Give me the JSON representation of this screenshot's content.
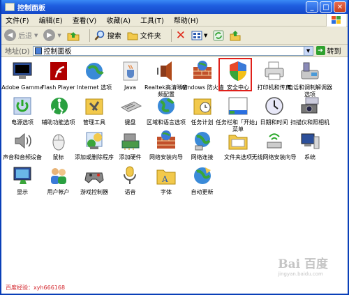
{
  "window": {
    "title": "控制面板"
  },
  "menu": [
    "文件(F)",
    "编辑(E)",
    "查看(V)",
    "收藏(A)",
    "工具(T)",
    "帮助(H)"
  ],
  "toolbar": {
    "back": "后退",
    "search": "搜索",
    "folders": "文件夹"
  },
  "address": {
    "label": "地址(D)",
    "value": "控制面板",
    "go": "转到"
  },
  "items": [
    {
      "label": "Adobe Gamma",
      "icon": "monitor-icon"
    },
    {
      "label": "Flash Player",
      "icon": "flash-icon"
    },
    {
      "label": "Internet 选项",
      "icon": "globe-icon"
    },
    {
      "label": "Java",
      "icon": "java-icon"
    },
    {
      "label": "Realtek高清晰音频配置",
      "icon": "speaker-icon"
    },
    {
      "label": "Windows 防火墙",
      "icon": "firewall-icon"
    },
    {
      "label": "安全中心",
      "icon": "shield-icon"
    },
    {
      "label": "打印机和传真",
      "icon": "printer-icon"
    },
    {
      "label": "电话和调制解调器选项",
      "icon": "phone-icon"
    },
    {
      "label": "电源选项",
      "icon": "power-icon"
    },
    {
      "label": "辅助功能选项",
      "icon": "accessibility-icon"
    },
    {
      "label": "管理工具",
      "icon": "admin-tools-icon"
    },
    {
      "label": "键盘",
      "icon": "keyboard-icon"
    },
    {
      "label": "区域和语言选项",
      "icon": "region-icon"
    },
    {
      "label": "任务计划",
      "icon": "scheduled-tasks-icon"
    },
    {
      "label": "任务栏和「开始」菜单",
      "icon": "taskbar-icon"
    },
    {
      "label": "日期和时间",
      "icon": "clock-icon"
    },
    {
      "label": "扫描仪和照相机",
      "icon": "camera-icon"
    },
    {
      "label": "声音和音频设备",
      "icon": "sound-icon"
    },
    {
      "label": "鼠标",
      "icon": "mouse-icon"
    },
    {
      "label": "添加或删除程序",
      "icon": "add-remove-icon"
    },
    {
      "label": "添加硬件",
      "icon": "add-hardware-icon"
    },
    {
      "label": "网络安装向导",
      "icon": "network-wizard-icon"
    },
    {
      "label": "网络连接",
      "icon": "network-icon"
    },
    {
      "label": "文件夹选项",
      "icon": "folder-icon"
    },
    {
      "label": "无线网络安装向导",
      "icon": "wireless-icon"
    },
    {
      "label": "系统",
      "icon": "system-icon"
    },
    {
      "label": "显示",
      "icon": "display-icon"
    },
    {
      "label": "用户帐户",
      "icon": "users-icon"
    },
    {
      "label": "游戏控制器",
      "icon": "gamepad-icon"
    },
    {
      "label": "语音",
      "icon": "speech-icon"
    },
    {
      "label": "字体",
      "icon": "fonts-icon"
    },
    {
      "label": "自动更新",
      "icon": "update-icon"
    }
  ],
  "selected_item": "安全中心",
  "watermark": "百度经验：xyh666168",
  "logo": {
    "main": "Bai 百度",
    "sub": "jingyan.baidu.com"
  },
  "colors": {
    "title_bar": "#1f5fe0",
    "selection_outline": "#e0201a",
    "watermark": "#d2232a"
  }
}
